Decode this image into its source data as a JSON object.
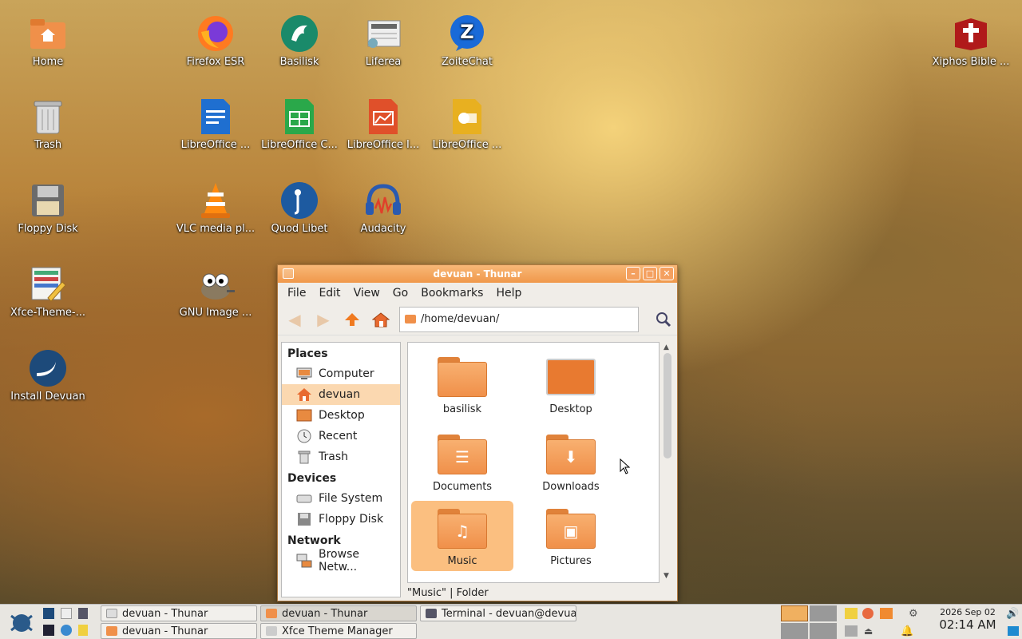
{
  "desktop": {
    "icons": [
      {
        "label": "Home"
      },
      {
        "label": "Trash"
      },
      {
        "label": "Floppy Disk"
      },
      {
        "label": "Xfce-Theme-..."
      },
      {
        "label": "Install Devuan"
      },
      {
        "label": "Firefox ESR"
      },
      {
        "label": "Basilisk"
      },
      {
        "label": "Liferea"
      },
      {
        "label": "ZoiteChat"
      },
      {
        "label": "LibreOffice ..."
      },
      {
        "label": "LibreOffice C..."
      },
      {
        "label": "LibreOffice I..."
      },
      {
        "label": "LibreOffice ..."
      },
      {
        "label": "VLC media pl..."
      },
      {
        "label": "Quod Libet"
      },
      {
        "label": "Audacity"
      },
      {
        "label": "GNU Image ..."
      },
      {
        "label": "Xiphos Bible ..."
      }
    ]
  },
  "window": {
    "title": "devuan - Thunar",
    "menu": [
      "File",
      "Edit",
      "View",
      "Go",
      "Bookmarks",
      "Help"
    ],
    "path": "/home/devuan/",
    "sidebar": {
      "places_title": "Places",
      "places": [
        "Computer",
        "devuan",
        "Desktop",
        "Recent",
        "Trash"
      ],
      "devices_title": "Devices",
      "devices": [
        "File System",
        "Floppy Disk"
      ],
      "network_title": "Network",
      "network": [
        "Browse Netw..."
      ]
    },
    "files": [
      "basilisk",
      "Desktop",
      "Documents",
      "Downloads",
      "Music",
      "Pictures"
    ],
    "status": "\"Music\"  |  Folder"
  },
  "panel": {
    "tasks": [
      "devuan - Thunar",
      "devuan - Thunar",
      "Terminal - devuan@devua...",
      "devuan - Thunar",
      "Xfce Theme Manager"
    ],
    "date": "2026 Sep 02",
    "time": "02:14 AM"
  }
}
